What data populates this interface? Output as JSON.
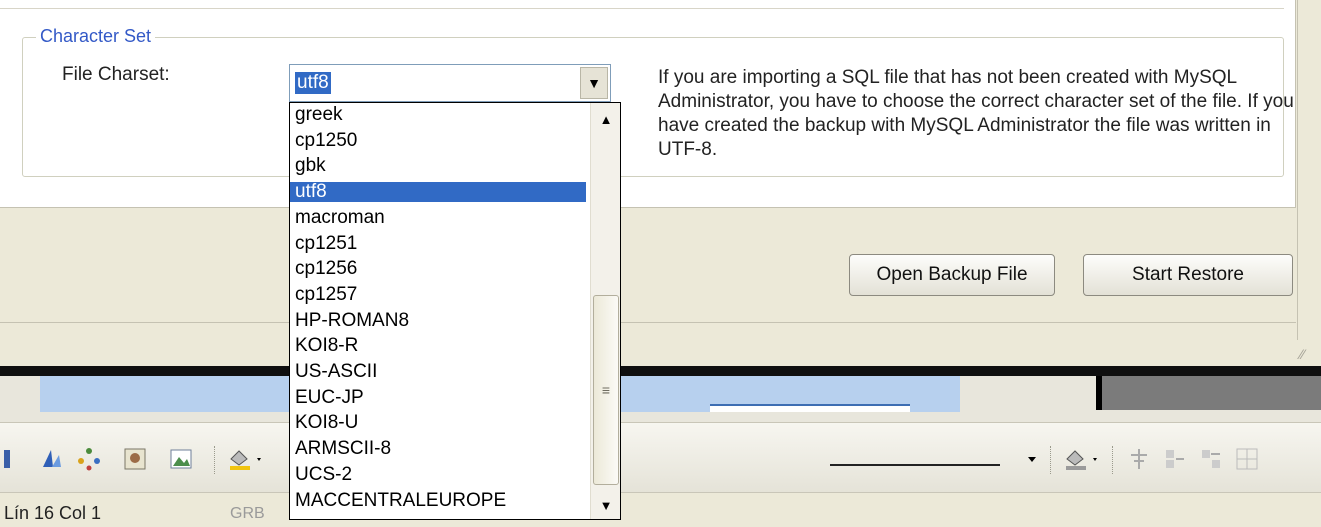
{
  "character_set": {
    "group_title": "Character Set",
    "label": "File Charset:",
    "selected_value": "utf8",
    "help_text": "If you are importing a SQL file that has not been created with MySQL Administrator, you have to choose the correct character set of the file. If you have created the backup with MySQL Administrator the file was written in UTF-8.",
    "options": [
      "greek",
      "cp1250",
      "gbk",
      "utf8",
      "macroman",
      "cp1251",
      "cp1256",
      "cp1257",
      "HP-ROMAN8",
      "KOI8-R",
      "US-ASCII",
      "EUC-JP",
      "KOI8-U",
      "ARMSCII-8",
      "UCS-2",
      "MACCENTRALEUROPE"
    ],
    "selected_index": 3
  },
  "buttons": {
    "open_backup": "Open Backup File",
    "start_restore": "Start Restore"
  },
  "status_bar": {
    "position": "Lín 16   Col 1",
    "mode": "GRB"
  },
  "icons": {
    "combo_arrow": "▼",
    "scroll_up": "▲",
    "scroll_down": "▼",
    "thumb_grip": "≡",
    "resize_grip": "⁄⁄"
  },
  "colors": {
    "selection": "#316ac5",
    "group_title": "#3359c7"
  }
}
